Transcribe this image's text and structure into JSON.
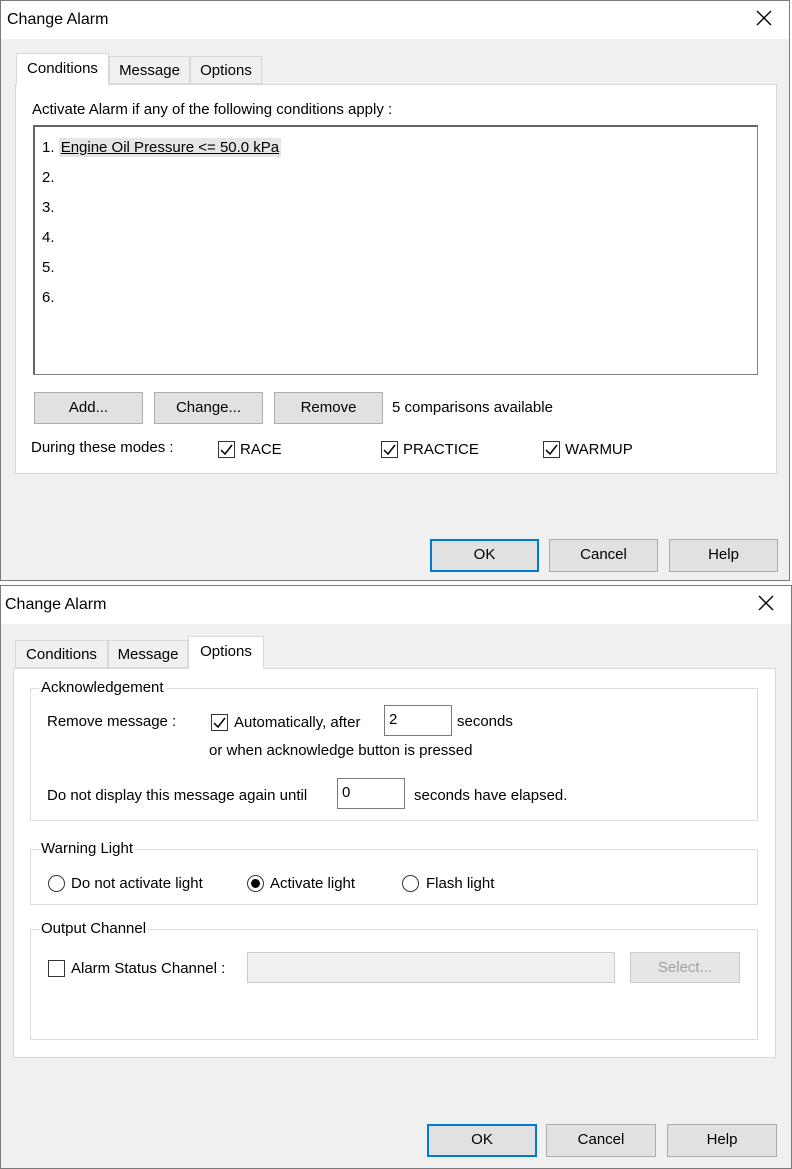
{
  "dialog1": {
    "title": "Change Alarm",
    "tabs": [
      "Conditions",
      "Message",
      "Options"
    ],
    "instruction": "Activate Alarm if any of the following conditions apply :",
    "conditions": [
      {
        "num": "1.",
        "text": "Engine Oil Pressure <= 50.0 kPa"
      },
      {
        "num": "2.",
        "text": ""
      },
      {
        "num": "3.",
        "text": ""
      },
      {
        "num": "4.",
        "text": ""
      },
      {
        "num": "5.",
        "text": ""
      },
      {
        "num": "6.",
        "text": ""
      }
    ],
    "buttons": {
      "add": "Add...",
      "change": "Change...",
      "remove": "Remove"
    },
    "available": "5 comparisons available",
    "modes_label": "During these modes :",
    "modes": [
      {
        "label": "RACE",
        "checked": true
      },
      {
        "label": "PRACTICE",
        "checked": true
      },
      {
        "label": "WARMUP",
        "checked": true
      }
    ],
    "footer": {
      "ok": "OK",
      "cancel": "Cancel",
      "help": "Help"
    }
  },
  "dialog2": {
    "title": "Change Alarm",
    "tabs": [
      "Conditions",
      "Message",
      "Options"
    ],
    "ack": {
      "legend": "Acknowledgement",
      "remove_label": "Remove message :",
      "auto_label": "Automatically, after",
      "auto_checked": true,
      "seconds_value": "2",
      "seconds_label": "seconds",
      "or_label": "or when acknowledge button is pressed",
      "donot_label": "Do not display this message again until",
      "elapsed_value": "0",
      "elapsed_label": "seconds have elapsed."
    },
    "warning": {
      "legend": "Warning Light",
      "options": [
        {
          "label": "Do not activate light",
          "selected": false
        },
        {
          "label": "Activate light",
          "selected": true
        },
        {
          "label": "Flash light",
          "selected": false
        }
      ]
    },
    "output": {
      "legend": "Output Channel",
      "status_label": "Alarm Status Channel :",
      "status_checked": false,
      "channel_value": "",
      "select_label": "Select..."
    },
    "footer": {
      "ok": "OK",
      "cancel": "Cancel",
      "help": "Help"
    }
  },
  "icons": [
    "close-icon",
    "checkbox-checked-icon",
    "checkbox-unchecked-icon",
    "radio-selected-icon",
    "radio-unselected-icon"
  ],
  "colors": {
    "accent": "#0078d7",
    "panel": "#f0f0f0",
    "window": "#ffffff"
  }
}
